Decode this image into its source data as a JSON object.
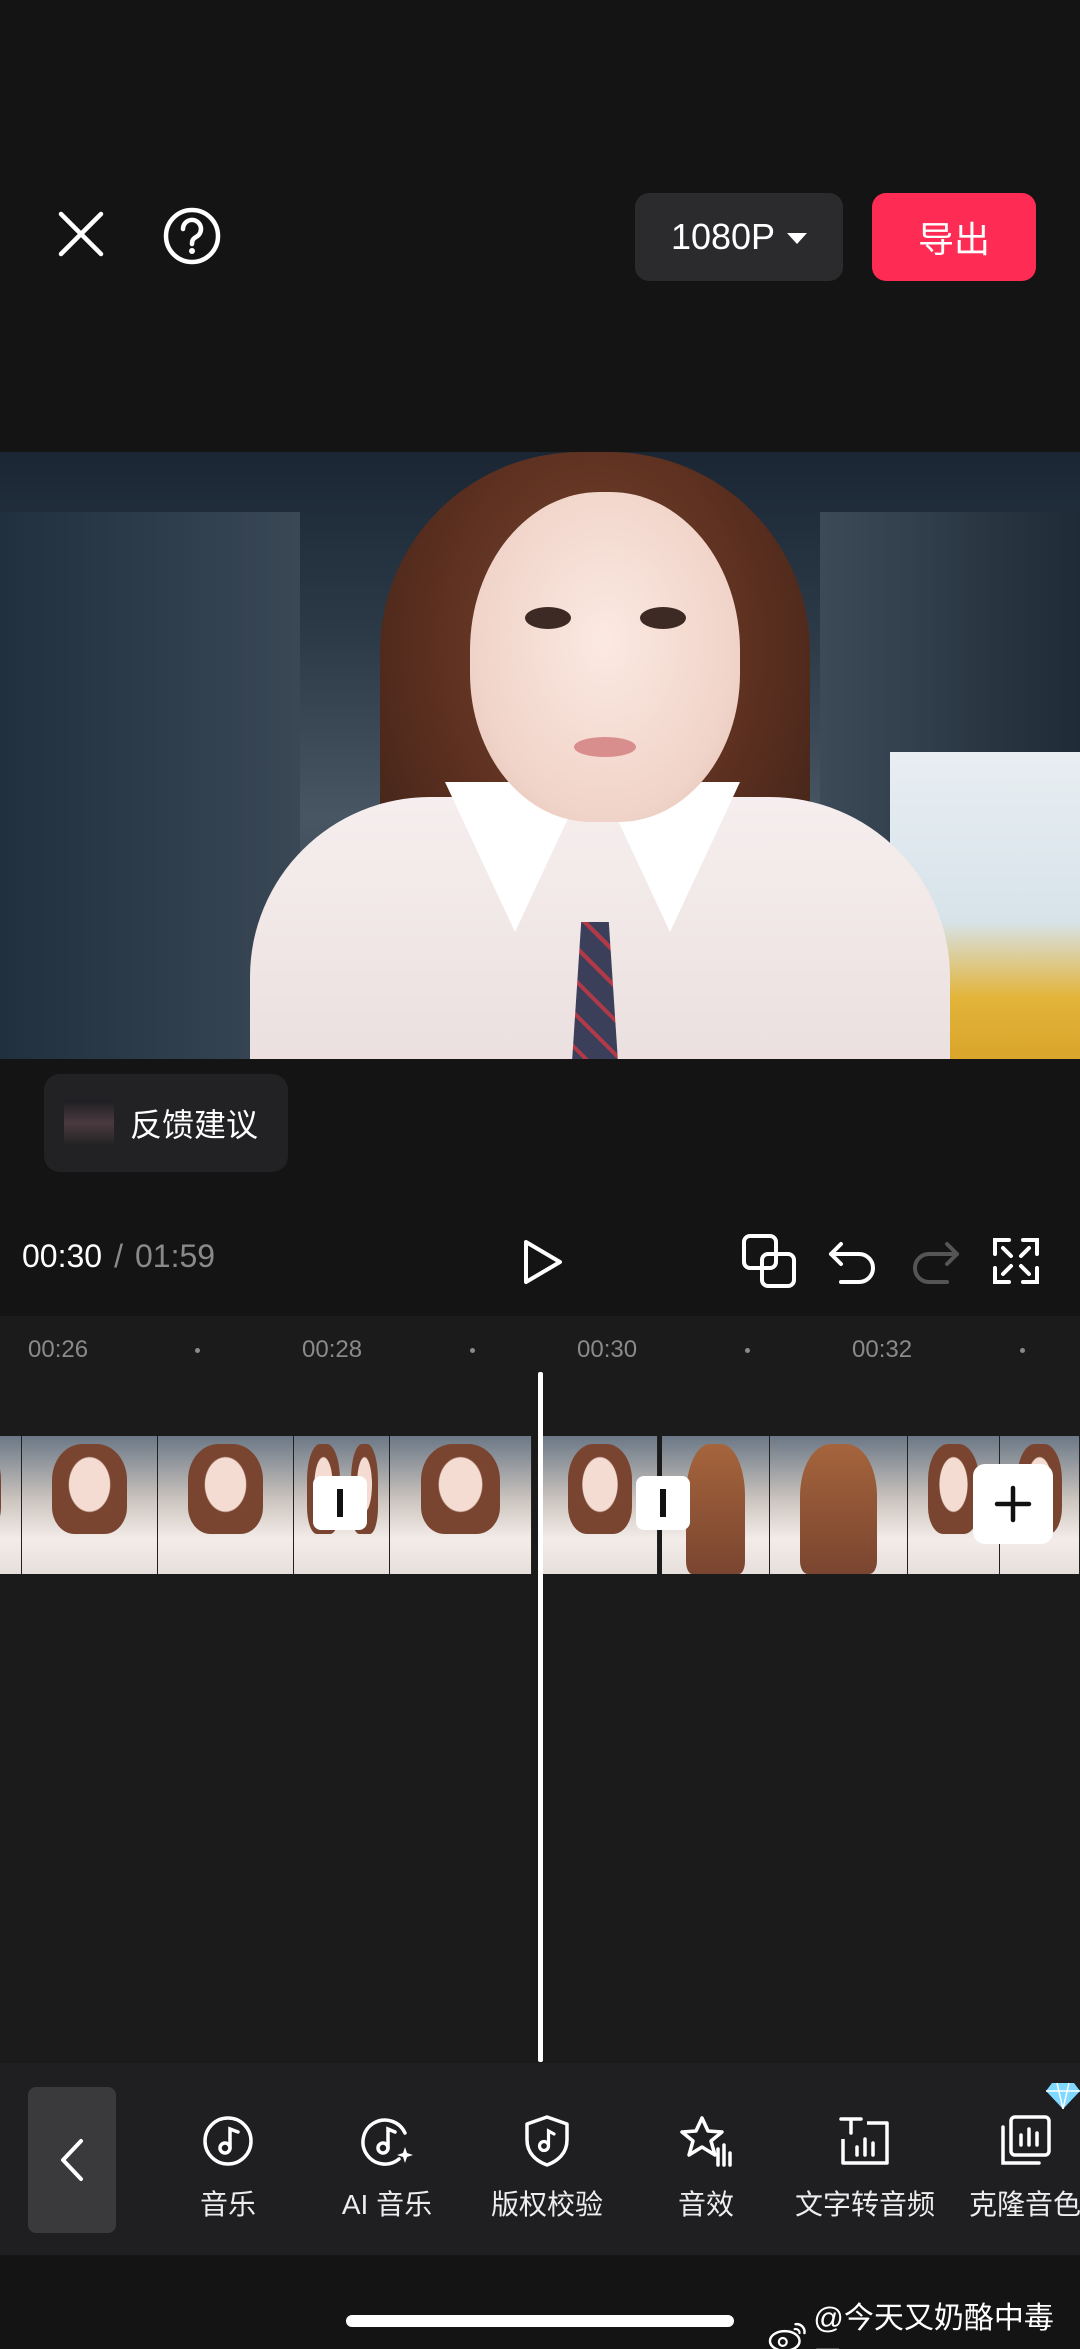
{
  "header": {
    "resolution_label": "1080P",
    "export_label": "导出"
  },
  "feedback": {
    "label": "反馈建议"
  },
  "playback": {
    "current_time": "00:30",
    "separator": "/",
    "total_time": "01:59"
  },
  "timeline": {
    "ruler_labels": [
      "00:26",
      "00:28",
      "00:30",
      "00:32"
    ]
  },
  "toolbar": {
    "items": [
      {
        "label": "音乐",
        "icon": "music-note-icon"
      },
      {
        "label": "AI 音乐",
        "icon": "ai-music-icon"
      },
      {
        "label": "版权校验",
        "icon": "copyright-shield-icon"
      },
      {
        "label": "音效",
        "icon": "sound-effect-star-icon"
      },
      {
        "label": "文字转音频",
        "icon": "text-to-audio-icon"
      },
      {
        "label": "克隆音色",
        "icon": "clone-voice-icon"
      }
    ]
  },
  "watermark": {
    "text": "@今天又奶酪中毒了"
  },
  "colors": {
    "accent": "#fe2c55",
    "background": "#141414",
    "panel": "#1f1f21"
  }
}
